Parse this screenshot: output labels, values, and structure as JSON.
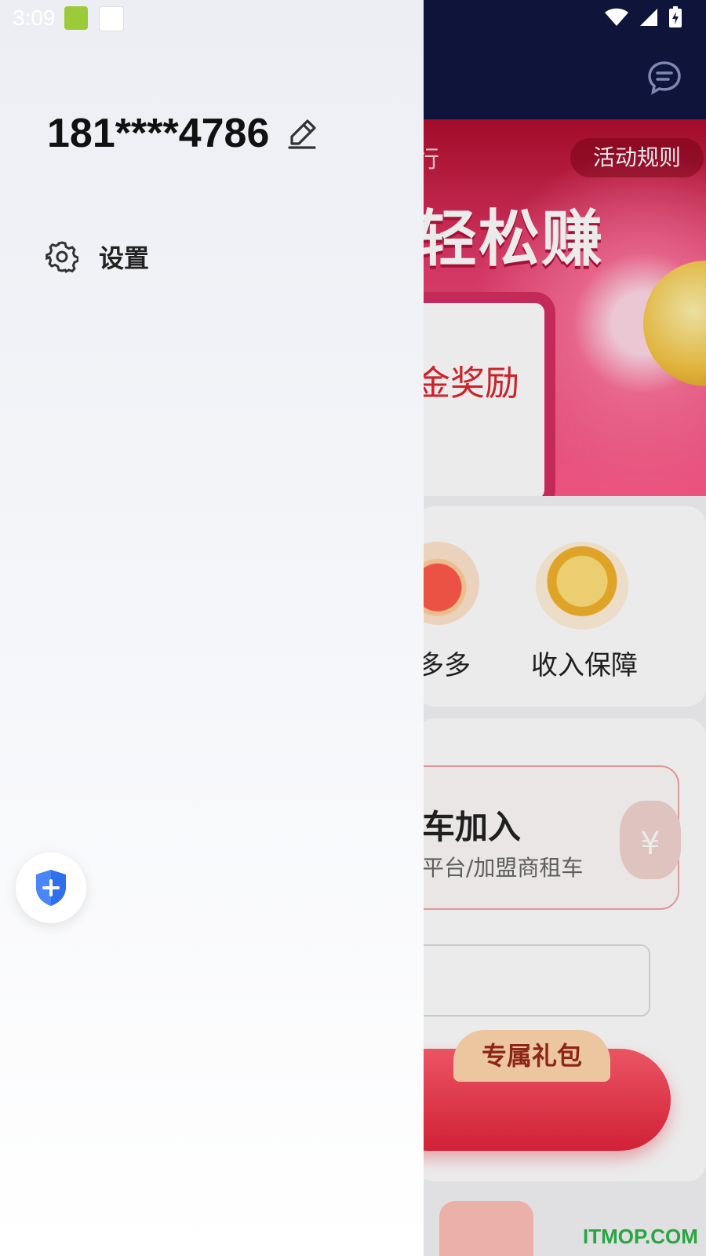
{
  "status_bar": {
    "time": "3:09"
  },
  "drawer": {
    "phone_number": "181****4786",
    "menu": [
      {
        "label": "设置",
        "icon": "gear-icon"
      }
    ]
  },
  "background_page": {
    "rules_label": "活动规则",
    "banner_side_text": "行",
    "banner_title": "轻松赚",
    "banner_reward": "金奖励",
    "icons": [
      {
        "label": "多多",
        "icon": "gift-icon"
      },
      {
        "label": "收入保障",
        "icon": "coin-stack-icon"
      }
    ],
    "join_title": "车加入",
    "join_subtitle": "平台/加盟商租车",
    "gift_tag": "专属礼包",
    "money_symbol": "¥"
  },
  "watermark": "ITMOP.COM",
  "colors": {
    "header": "#10163f",
    "banner": "#e43c6c",
    "accent_blue": "#2f6fec",
    "watermark": "#2db34a"
  }
}
